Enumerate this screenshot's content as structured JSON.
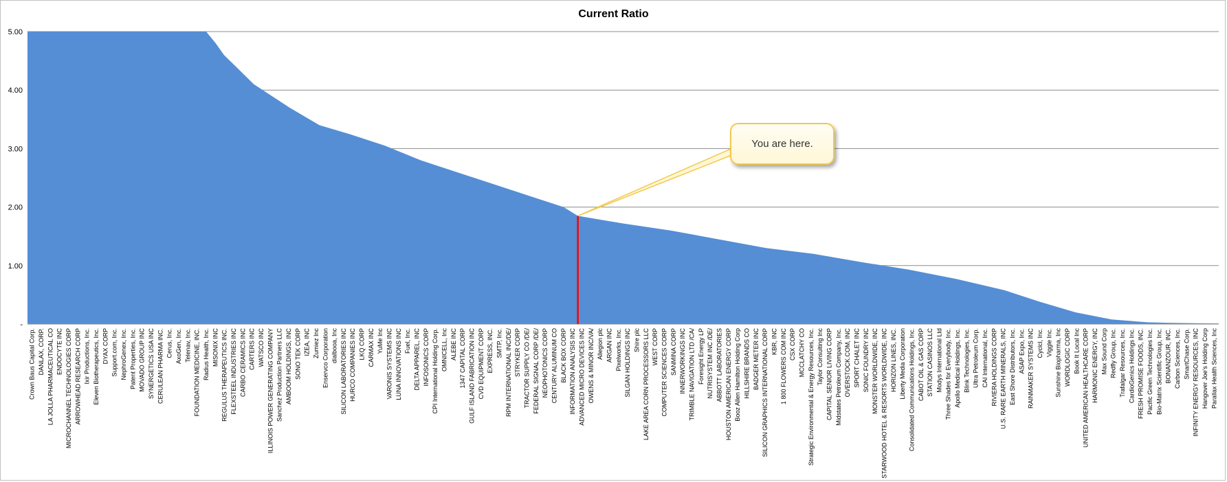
{
  "chart_data": {
    "type": "area",
    "title": "Current Ratio",
    "xlabel": "",
    "ylabel": "",
    "ylim": [
      0,
      5
    ],
    "y_ticks": [
      "5.00",
      "4.00",
      "3.00",
      "2.00",
      "1.00",
      "-"
    ],
    "y_tick_values": [
      5,
      4,
      3,
      2,
      1,
      0
    ],
    "grid": true,
    "legend": "none",
    "fill_color": "#558ed5",
    "marker_color": "#ff0000",
    "categories": [
      "Crown Baus Capital Corp.",
      "DANLAX, CORP.",
      "LA JOLLA PHARMACEUTICAL CO",
      "ENDOCYTE INC",
      "MICROCHANNEL TECHNOLOGIES CORP",
      "ARROWHEAD RESEARCH CORP",
      "Ixir Productions, Inc.",
      "Eleven Biotherapeutics, Inc.",
      "DYAX CORP",
      "Support.com, Inc.",
      "NephroGenex, Inc.",
      "Patent Properties, Inc.",
      "MOVADO GROUP INC",
      "SYNERGETICS USA INC",
      "CERULEAN PHARMA INC.",
      "Cerus, Inc.",
      "AxoGen, Inc.",
      "Telenav, Inc.",
      "FOUNDATION MEDICINE, INC.",
      "Radius Health, Inc.",
      "MISONIX INC",
      "REGULUS THERAPEUTICS INC.",
      "FLEXSTEEL INDUSTRIES INC",
      "CARBO CERAMICS INC",
      "CARTERS INC",
      "WATSCO INC",
      "ILLINOIS POWER GENERATING COMPANY",
      "Sanchez Production Partners LLC",
      "AMBOOM HOLDINGS, INC",
      "SONO TEK CORP",
      "IZEA, INC",
      "Zumiez Inc",
      "Enservco Corporation",
      "dialbooa, Inc",
      "SILICON LABORATORIES INC",
      "HURCO COMPANIES INC",
      "LKQ CORP",
      "CARMAX INC",
      "YuMe Inc",
      "VARONIS SYSTEMS INC",
      "LUNA INNOVATIONS INC",
      "Fuel, Inc.",
      "DELTA APPAREL, INC",
      "INFOSONICS CORP",
      "CPI International Holding Corp.",
      "OMNICELL, Inc",
      "ALEBE INC",
      "1347 CAPITAL CORP",
      "GULF ISLAND FABRICATION INC",
      "CVD EQUIPMENT CORP",
      "EXPRESS, INC.",
      "SMTP, Inc.",
      "RPM INTERNATIONAL INC/DE/",
      "STRYKER CORP",
      "TRACTOR SUPPLY CO /DE/",
      "FEDERAL SIGNAL CORP /DE/",
      "NEOPHOTONICS CORP",
      "CENTURY ALUMINUM CO",
      "BLACK BOX CORP",
      "INFORMATION ANALYSIS INC",
      "ADVANCED MICRO DEVICES INC",
      "OWENS & MINOR INC/VA/",
      "Allegion plc",
      "ARGAN INC",
      "Pixelworks, Inc.",
      "SILGAN HOLDINGS INC",
      "Shire plc",
      "LAKE AREA CORN PROCESSORS LLC",
      "WEST CORP",
      "COMPUTER SCIENCES CORP",
      "SANMINA CORP",
      "INNERWORKINGS INC",
      "TRIMBLE NAVIGATION LTD /CA/",
      "Foresight Energy LP",
      "NUTRISYSTEM INC /DE/",
      "ABBOTT LABORATORIES",
      "HOUSTON AMERICAN ENERGY CORP",
      "Booz Allen Hamilton Holding Corp",
      "HILLSHIRE BRANDS CO",
      "BADGER METER INC",
      "SILICON GRAPHICS INTERNATIONAL CORP",
      "KBR, INC",
      "1 800 FLOWERS COM INC",
      "CSX CORP",
      "MCCLATCHY CO",
      "Strategic Environmental & Energy Resources, Inc.",
      "Taylor Consulting Inc",
      "CAPITAL SENIOR LIVING CORP",
      "Midstates Petroleum Company, Inc.",
      "OVERSTOCK.COM, INC",
      "SPORT CHALET INC",
      "SONIC FOUNDRY INC",
      "MONSTER WORLDWIDE, INC",
      "STARWOOD HOTEL & RESORTS WORLDWIDE, INC",
      "HORIZON LINES, INC.",
      "Liberty Media Corporation",
      "Consolidated Communications Holdings, Inc.",
      "CABOT OIL & GAS CORP",
      "STATION CASINOS LLC",
      "Modys International Ltd",
      "Three Shades for Everybody, Inc.",
      "Apollo Medical Holdings, Inc.",
      "Blink Technologies, Inc.",
      "Ultra Petroleum Corp.",
      "CAI International, Inc.",
      "RIVIERA HOLDINGS CORP",
      "U.S. RARE EARTH MINERALS, INC",
      "East Shore Distributors, Inc.",
      "ASAP Expo, Inc.",
      "RAINMAKER SYSTEMS INC",
      "Cyclcl, Inc.",
      "Viggle Inc.",
      "Sunshine Biopharma, Inc",
      "WORDLOGIC CORP",
      "Book It Local Inc",
      "UNITED AMERICAN HEALTHCARE CORP",
      "HARMONIC ENERGY, INC",
      "Max Sound Corp",
      "Redfly Group, Inc.",
      "Trafalgar Resources, Inc.",
      "CardioGenics Holdings Inc.",
      "FRESH PROMISE FOODS, INC.",
      "Pacific Green Technologies Inc.",
      "Bio-Matrix Scientific Group, Inc.",
      "BONANZOUR, INC.",
      "Carbon Sciences, Inc.",
      "SmartChase Corp.",
      "INFINITY ENERGY RESOURCES, INC",
      "Hangover Joe's Holding Corp",
      "Parallax Health Sciences, Inc"
    ],
    "curve": {
      "x": [
        0,
        0.15,
        0.158,
        0.165,
        0.175,
        0.19,
        0.205,
        0.22,
        0.245,
        0.27,
        0.3,
        0.33,
        0.36,
        0.39,
        0.42,
        0.45,
        0.462,
        0.5,
        0.54,
        0.58,
        0.62,
        0.66,
        0.7,
        0.74,
        0.78,
        0.82,
        0.85,
        0.88,
        0.91,
        0.94,
        0.96,
        0.98,
        1.0
      ],
      "y": [
        5.0,
        5.0,
        4.8,
        4.6,
        4.4,
        4.1,
        3.9,
        3.7,
        3.4,
        3.25,
        3.05,
        2.8,
        2.6,
        2.4,
        2.2,
        2.0,
        1.85,
        1.72,
        1.6,
        1.45,
        1.3,
        1.2,
        1.06,
        0.93,
        0.77,
        0.58,
        0.38,
        0.2,
        0.08,
        0.03,
        0.02,
        0.015,
        0.01
      ]
    },
    "marker": {
      "x": 0.462,
      "y": 1.85
    },
    "annotation": "You are here."
  }
}
